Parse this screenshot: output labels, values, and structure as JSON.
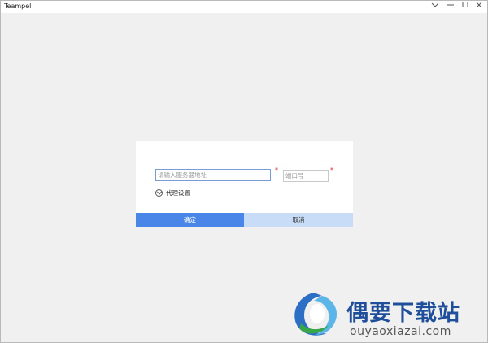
{
  "window": {
    "title": "Teampel",
    "controls": [
      "chevron-down-icon",
      "minimize-icon",
      "maximize-icon",
      "close-icon"
    ]
  },
  "dialog": {
    "server_placeholder": "请输入服务器地址",
    "server_value": "",
    "port_placeholder": "端口号",
    "port_value": "",
    "required_mark": "*",
    "proxy_label": "代理设置",
    "ok_label": "确定",
    "cancel_label": "取消"
  },
  "watermark": {
    "site_name": "偶要下载站",
    "url": "ouyaoxiazai.com"
  },
  "colors": {
    "ok_button": "#4a86e8",
    "cancel_button": "#c9dcf7",
    "required": "#e02020",
    "watermark_text": "#1f4f9a"
  }
}
